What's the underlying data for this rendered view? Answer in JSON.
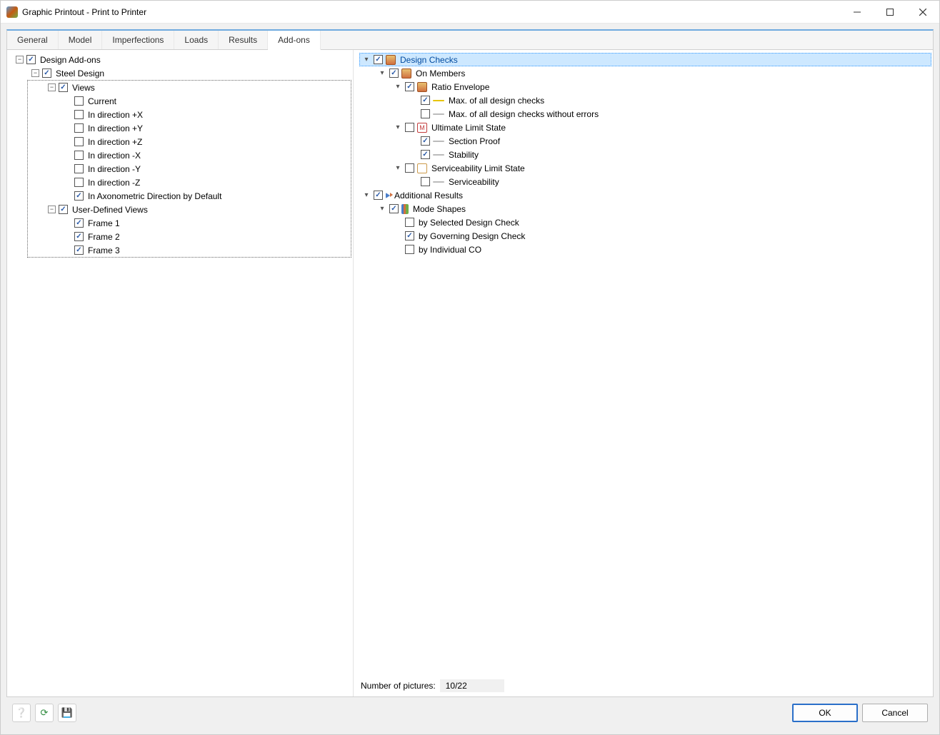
{
  "window": {
    "title": "Graphic Printout - Print to Printer"
  },
  "tabs": [
    "General",
    "Model",
    "Imperfections",
    "Loads",
    "Results",
    "Add-ons"
  ],
  "active_tab": "Add-ons",
  "left_tree": {
    "root": {
      "label": "Design Add-ons",
      "checked": true,
      "expanded": true
    },
    "steel": {
      "label": "Steel Design",
      "checked": true,
      "expanded": true
    },
    "views": {
      "label": "Views",
      "checked": true,
      "expanded": true,
      "items": [
        {
          "label": "Current",
          "checked": false
        },
        {
          "label": "In direction +X",
          "checked": false
        },
        {
          "label": "In direction +Y",
          "checked": false
        },
        {
          "label": "In direction +Z",
          "checked": false
        },
        {
          "label": "In direction -X",
          "checked": false
        },
        {
          "label": "In direction -Y",
          "checked": false
        },
        {
          "label": "In direction -Z",
          "checked": false
        },
        {
          "label": "In Axonometric Direction by Default",
          "checked": true
        }
      ]
    },
    "udv": {
      "label": "User-Defined Views",
      "checked": true,
      "expanded": true,
      "items": [
        {
          "label": "Frame 1",
          "checked": true
        },
        {
          "label": "Frame 2",
          "checked": true
        },
        {
          "label": "Frame 3",
          "checked": true
        }
      ]
    }
  },
  "right_tree": {
    "design_checks": {
      "label": "Design Checks",
      "checked": true,
      "expanded": true
    },
    "on_members": {
      "label": "On Members",
      "checked": true,
      "expanded": true
    },
    "ratio_env": {
      "label": "Ratio Envelope",
      "checked": true,
      "expanded": true,
      "items": [
        {
          "label": "Max. of all design checks",
          "checked": true,
          "icon": "yellow"
        },
        {
          "label": "Max. of all design checks without errors",
          "checked": false,
          "icon": "gray"
        }
      ]
    },
    "uls": {
      "label": "Ultimate Limit State",
      "checked": false,
      "expanded": true,
      "items": [
        {
          "label": "Section Proof",
          "checked": true,
          "icon": "gray"
        },
        {
          "label": "Stability",
          "checked": true,
          "icon": "gray"
        }
      ]
    },
    "sls": {
      "label": "Serviceability Limit State",
      "checked": false,
      "expanded": true,
      "items": [
        {
          "label": "Serviceability",
          "checked": false,
          "icon": "gray"
        }
      ]
    },
    "addl": {
      "label": "Additional Results",
      "checked": true,
      "expanded": true
    },
    "modes": {
      "label": "Mode Shapes",
      "checked": true,
      "expanded": true,
      "items": [
        {
          "label": "by Selected Design Check",
          "checked": false
        },
        {
          "label": "by Governing Design Check",
          "checked": true
        },
        {
          "label": "by Individual CO",
          "checked": false
        }
      ]
    }
  },
  "footer": {
    "label": "Number of pictures:",
    "value": "10/22"
  },
  "buttons": {
    "ok": "OK",
    "cancel": "Cancel"
  }
}
